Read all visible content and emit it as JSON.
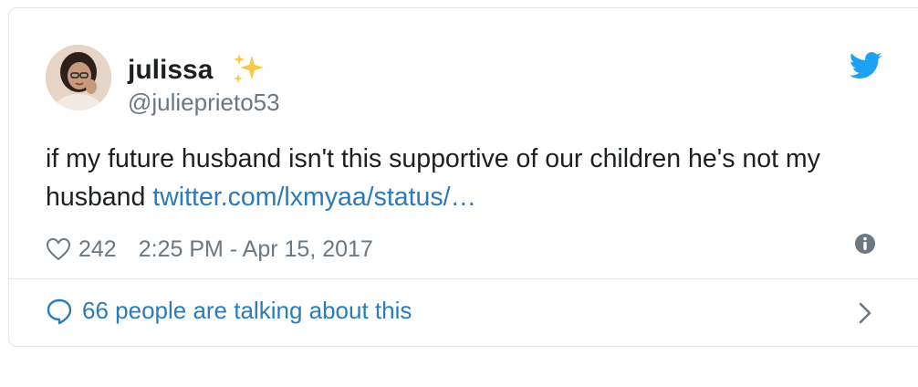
{
  "author": {
    "display_name": "julissa",
    "emoji": "sparkles-icon",
    "handle": "@julieprieto53"
  },
  "tweet": {
    "text": "if my future husband isn't this supportive of our children he's not my husband ",
    "link_text": "twitter.com/lxmyaa/status/…"
  },
  "meta": {
    "likes": "242",
    "timestamp": "2:25 PM - Apr 15, 2017"
  },
  "footer": {
    "talking_label": "66 people are talking about this"
  },
  "colors": {
    "link": "#2b7bb9",
    "muted": "#697882",
    "text": "#1c2022",
    "border": "#e1e8ed",
    "twitter_blue": "#1da1f2"
  }
}
